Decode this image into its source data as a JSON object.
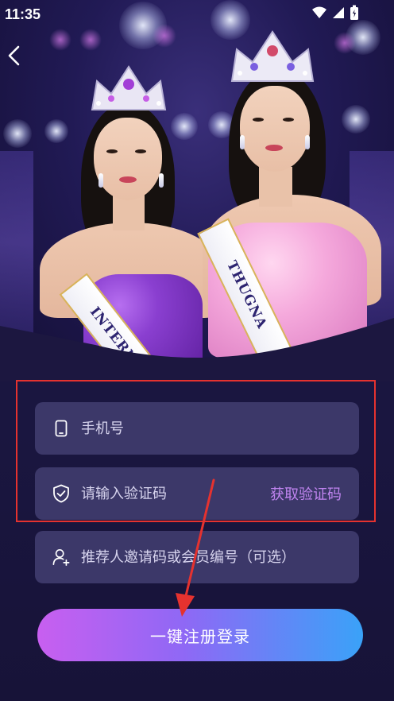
{
  "status_bar": {
    "time": "11:35"
  },
  "hero": {
    "sash_left_text": "INTERNC",
    "sash_right_text": "THUGNA"
  },
  "form": {
    "phone": {
      "placeholder": "手机号",
      "icon": "phone-icon"
    },
    "code": {
      "placeholder": "请输入验证码",
      "icon": "shield-check-icon",
      "get_code_label": "获取验证码"
    },
    "referral": {
      "placeholder": "推荐人邀请码或会员编号（可选）",
      "icon": "add-user-icon"
    },
    "submit_label": "一键注册登录"
  },
  "colors": {
    "background": "#1c1740",
    "field_bg": "#3c3869",
    "accent_purple": "#c084f0",
    "button_gradient_start": "#c85ff0",
    "button_gradient_end": "#3aa2f8",
    "highlight_border": "#e5322f"
  }
}
